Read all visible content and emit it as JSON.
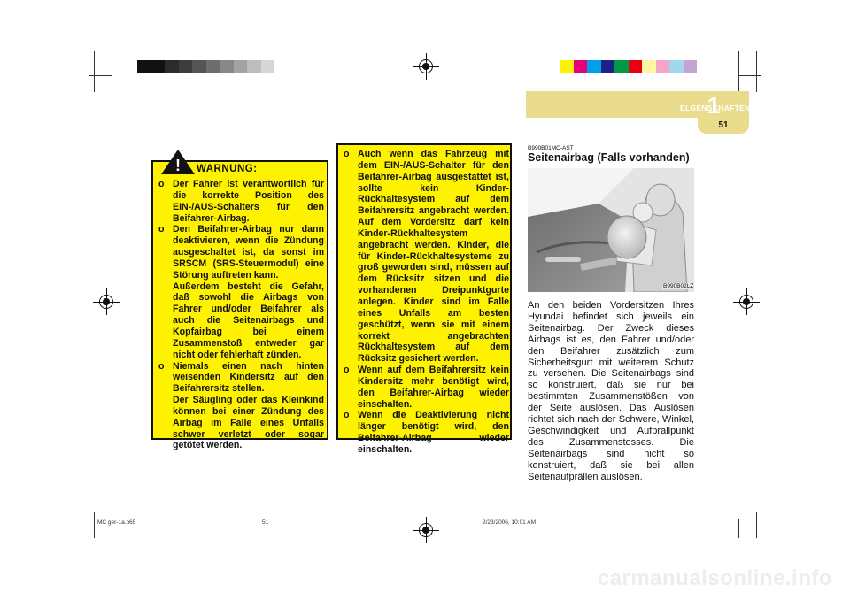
{
  "header": {
    "section_title": "ELGENSCHAFTEN DES HYUNDAI",
    "chapter_number": "1",
    "page_number": "51"
  },
  "colors": {
    "warning_box": "#fff200",
    "header_band": "#e9dc8c",
    "left_color_bar": [
      "#111111",
      "#111111",
      "#2b2b2b",
      "#3d3d3d",
      "#555555",
      "#6e6e6e",
      "#888888",
      "#a3a3a3",
      "#bdbdbd",
      "#d6d6d6",
      "#ffffff"
    ],
    "right_color_bar": [
      "#fff200",
      "#e6007e",
      "#00a0e9",
      "#1d2088",
      "#009944",
      "#e60012",
      "#fff8a0",
      "#f6a5c8",
      "#a0d8ef",
      "#c3a5d0"
    ]
  },
  "warning": {
    "icon": "warning-triangle-icon",
    "heading": "WARNUNG:",
    "bullet": "o",
    "items": [
      {
        "lines": [
          "Der Fahrer ist verantwortlich für die korrekte Position des EIN-/AUS-Schalters für den Beifahrer-Airbag."
        ]
      },
      {
        "lines": [
          "Den Beifahrer-Airbag nur dann deaktivieren, wenn die Zündung ausgeschaltet ist, da sonst im SRSCM (SRS-Steuermodul) eine Störung auftreten kann.",
          "Außerdem besteht die Gefahr, daß sowohl die Airbags von Fahrer und/oder Beifahrer als auch die Seitenairbags und Kopfairbag bei einem Zusammenstoß entweder gar nicht oder fehlerhaft zünden."
        ]
      },
      {
        "lines": [
          "Niemals einen nach hinten weisenden Kindersitz auf den Beifahrersitz stellen.",
          "Der Säugling oder das Kleinkind können bei einer Zündung des Airbag im Falle eines Unfalls schwer verletzt oder sogar getötet werden."
        ]
      }
    ]
  },
  "middle_box": {
    "items": [
      "Auch wenn das Fahrzeug mit dem EIN-/AUS-Schalter für den Beifahrer-Airbag ausgestattet ist, sollte kein Kinder-Rückhaltesystem auf dem Beifahrersitz angebracht werden. Auf dem Vordersitz darf kein Kinder-Rückhaltesystem angebracht werden. Kinder, die für Kinder-Rückhaltesysteme zu groß geworden sind, müssen auf dem Rücksitz sitzen und die vorhandenen Dreipunktgurte anlegen. Kinder sind im Falle eines Unfalls am besten geschützt, wenn sie mit einem korrekt angebrachten Rückhaltesystem auf dem Rücksitz gesichert werden.",
      "Wenn auf dem Beifahrersitz kein Kindersitz mehr benötigt wird, den Beifahrer-Airbag wieder einschalten.",
      "Wenn die Deaktivierung nicht länger benötigt wird, den Beifahrer-Airbag wieder einschalten."
    ]
  },
  "section": {
    "code": "B990B01MC-AST",
    "title": "Seitenairbag (Falls vorhanden)",
    "image_code": "B990B02LZ",
    "body": "An den beiden Vordersitzen Ihres Hyundai befindet sich jeweils ein Seitenairbag. Der Zweck dieses Airbags ist es, den Fahrer und/oder den Beifahrer zusätzlich zum Sicherheitsgurt mit weiterem Schutz zu versehen. Die Seitenairbags sind so konstruiert, daß sie nur bei bestimmten Zusammenstößen von der Seite auslösen. Das Auslösen richtet sich nach der Schwere, Winkel, Geschwindigkeit und Aufprallpunkt des Zusammenstosses. Die Seitenairbags sind nicht so konstruiert, daß sie bei allen Seitenaufprällen auslösen."
  },
  "footer": {
    "file": "MC ger-1a.p65",
    "page": "51",
    "timestamp": "2/23/2006, 10:01 AM"
  },
  "watermark": "carmanualsonline.info"
}
